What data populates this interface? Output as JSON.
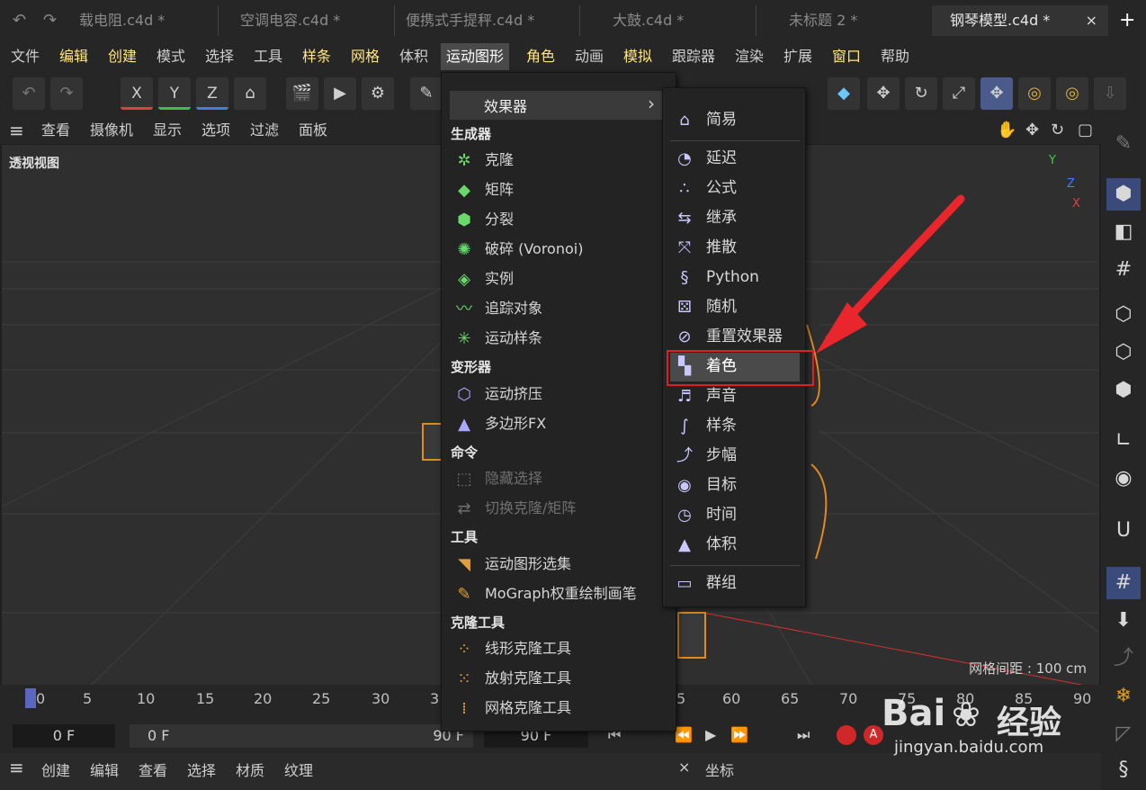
{
  "tabs": [
    {
      "label": "载电阻.c4d *"
    },
    {
      "label": "空调电容.c4d *"
    },
    {
      "label": "便携式手提秤.c4d *"
    },
    {
      "label": "大鼓.c4d *"
    },
    {
      "label": "未标题 2 *"
    },
    {
      "label": "钢琴模型.c4d *",
      "active": true
    }
  ],
  "tab_close": "×",
  "tab_add": "+",
  "menubar": [
    "文件",
    "编辑",
    "创建",
    "模式",
    "选择",
    "工具",
    "样条",
    "网格",
    "体积",
    "运动图形",
    "角色",
    "动画",
    "模拟",
    "跟踪器",
    "渲染",
    "扩展",
    "窗口",
    "帮助"
  ],
  "toolbar": {
    "x": "X",
    "y": "Y",
    "z": "Z"
  },
  "viewport_menu": [
    "查看",
    "摄像机",
    "显示",
    "选项",
    "过滤",
    "面板"
  ],
  "viewport": {
    "label": "透视视图",
    "grid_info": "网格间距 : 100 cm",
    "axis_y": "Y",
    "axis_z": "Z",
    "axis_x": "X"
  },
  "dropdown": {
    "effector_label": "效果器",
    "arrow": "›",
    "sections": [
      {
        "header": "生成器",
        "items": [
          {
            "label": "克隆",
            "icon": "clone-icon"
          },
          {
            "label": "矩阵",
            "icon": "matrix-icon"
          },
          {
            "label": "分裂",
            "icon": "fracture-icon"
          },
          {
            "label": "破碎 (Voronoi)",
            "icon": "voronoi-icon"
          },
          {
            "label": "实例",
            "icon": "instance-icon"
          },
          {
            "label": "追踪对象",
            "icon": "tracer-icon"
          },
          {
            "label": "运动样条",
            "icon": "motion-spline-icon"
          }
        ]
      },
      {
        "header": "变形器",
        "items": [
          {
            "label": "运动挤压",
            "icon": "extrude-icon"
          },
          {
            "label": "多边形FX",
            "icon": "polyfx-icon"
          }
        ]
      },
      {
        "header": "命令",
        "items": [
          {
            "label": "隐藏选择",
            "icon": "hide-selection-icon",
            "disabled": true
          },
          {
            "label": "切换克隆/矩阵",
            "icon": "toggle-clone-icon",
            "disabled": true
          }
        ]
      },
      {
        "header": "工具",
        "items": [
          {
            "label": "运动图形选集",
            "icon": "mograph-selection-icon"
          },
          {
            "label": "MoGraph权重绘制画笔",
            "icon": "weight-brush-icon"
          }
        ]
      },
      {
        "header": "克隆工具",
        "items": [
          {
            "label": "线形克隆工具",
            "icon": "linear-clone-icon"
          },
          {
            "label": "放射克隆工具",
            "icon": "radial-clone-icon"
          },
          {
            "label": "网格克隆工具",
            "icon": "grid-clone-icon"
          }
        ]
      }
    ]
  },
  "submenu": {
    "items": [
      {
        "label": "简易",
        "icon": "plain-icon"
      },
      {
        "label": "延迟",
        "icon": "delay-icon"
      },
      {
        "label": "公式",
        "icon": "formula-icon"
      },
      {
        "label": "继承",
        "icon": "inheritance-icon"
      },
      {
        "label": "推散",
        "icon": "push-apart-icon"
      },
      {
        "label": "Python",
        "icon": "python-icon"
      },
      {
        "label": "随机",
        "icon": "random-icon"
      },
      {
        "label": "重置效果器",
        "icon": "reeffector-icon"
      },
      {
        "label": "着色",
        "icon": "shader-icon",
        "highlighted": true
      },
      {
        "label": "声音",
        "icon": "sound-icon"
      },
      {
        "label": "样条",
        "icon": "spline-icon"
      },
      {
        "label": "步幅",
        "icon": "step-icon"
      },
      {
        "label": "目标",
        "icon": "target-icon"
      },
      {
        "label": "时间",
        "icon": "time-icon"
      },
      {
        "label": "体积",
        "icon": "volume-icon"
      },
      {
        "label": "群组",
        "icon": "group-icon"
      }
    ]
  },
  "timeline": {
    "ticks": [
      "0",
      "5",
      "10",
      "15",
      "20",
      "25",
      "30",
      "3",
      "5",
      "60",
      "65",
      "70",
      "75",
      "80",
      "85",
      "90"
    ]
  },
  "playbar": {
    "current_frame": "0 F",
    "start_frame": "0 F",
    "end_frame": "90 F",
    "end_frame2": "90 F"
  },
  "bottombar": {
    "left_menu": [
      "创建",
      "编辑",
      "查看",
      "选择",
      "材质",
      "纹理"
    ],
    "right_title": "坐标",
    "close": "×"
  },
  "watermark": {
    "brand": "Bai",
    "brand2": "经验",
    "url": "jingyan.baidu.com"
  },
  "colors": {
    "highlight_border": "#e02020",
    "menu_active": "#ffe680",
    "arrow": "#e8262c"
  }
}
